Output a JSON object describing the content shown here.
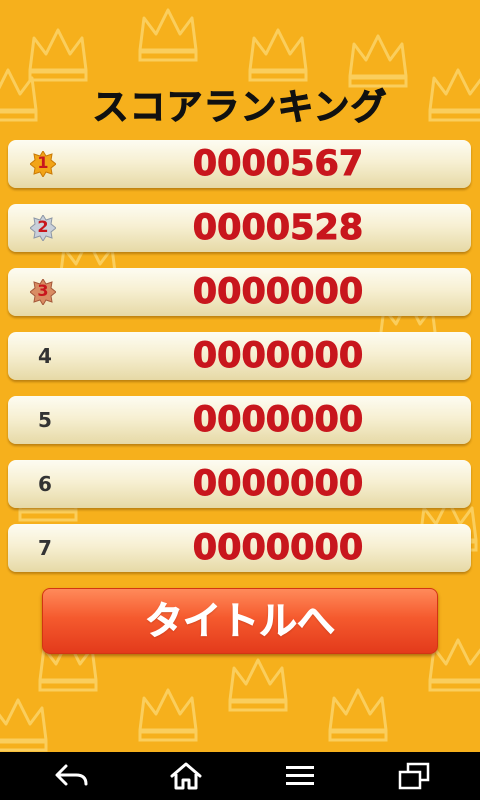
{
  "screen": {
    "title": "スコアランキング",
    "background_color": "#f6b01c",
    "accent_score_color": "#c8161d"
  },
  "ranking": [
    {
      "rank": "1",
      "score": "0000567",
      "medal": "gold"
    },
    {
      "rank": "2",
      "score": "0000528",
      "medal": "silver"
    },
    {
      "rank": "3",
      "score": "0000000",
      "medal": "bronze"
    },
    {
      "rank": "4",
      "score": "0000000",
      "medal": "none"
    },
    {
      "rank": "5",
      "score": "0000000",
      "medal": "none"
    },
    {
      "rank": "6",
      "score": "0000000",
      "medal": "none"
    },
    {
      "rank": "7",
      "score": "0000000",
      "medal": "none"
    }
  ],
  "buttons": {
    "to_title_label": "タイトルへ",
    "to_title_color": "#f04a24"
  },
  "navbar": {
    "items": [
      {
        "icon": "back-icon"
      },
      {
        "icon": "home-icon"
      },
      {
        "icon": "menu-icon"
      },
      {
        "icon": "recent-apps-icon"
      }
    ]
  }
}
